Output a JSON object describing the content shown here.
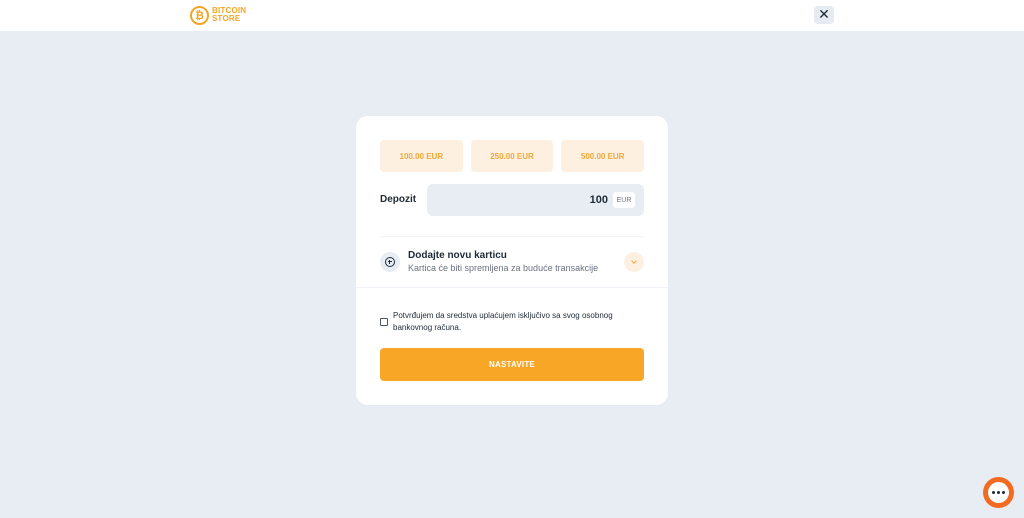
{
  "header": {
    "logo_text": "BITCOIN STORE",
    "logo_icon": "bitcoin-icon",
    "close_icon": "close-icon",
    "close_label": "✕"
  },
  "presets": [
    {
      "label": "100.00 EUR"
    },
    {
      "label": "250.00 EUR"
    },
    {
      "label": "500.00 EUR"
    }
  ],
  "deposit": {
    "label": "Depozit",
    "value": "100",
    "currency": "EUR"
  },
  "add_card": {
    "title": "Dodajte novu karticu",
    "subtitle": "Kartica će biti spremljena za buduće transakcije",
    "icon": "plus-circle-icon",
    "expand_icon": "chevron-down-icon"
  },
  "consent": {
    "text": "Potvrđujem da sredstva uplaćujem isključivo sa svog osobnog bankovnog računa.",
    "checked": false
  },
  "continue_button": {
    "label": "NASTAVITE"
  },
  "chat": {
    "icon": "chat-icon"
  },
  "colors": {
    "accent": "#f7a626",
    "accent_light": "#fdf0e0",
    "background": "#e8edf4",
    "chat": "#f26b21"
  }
}
